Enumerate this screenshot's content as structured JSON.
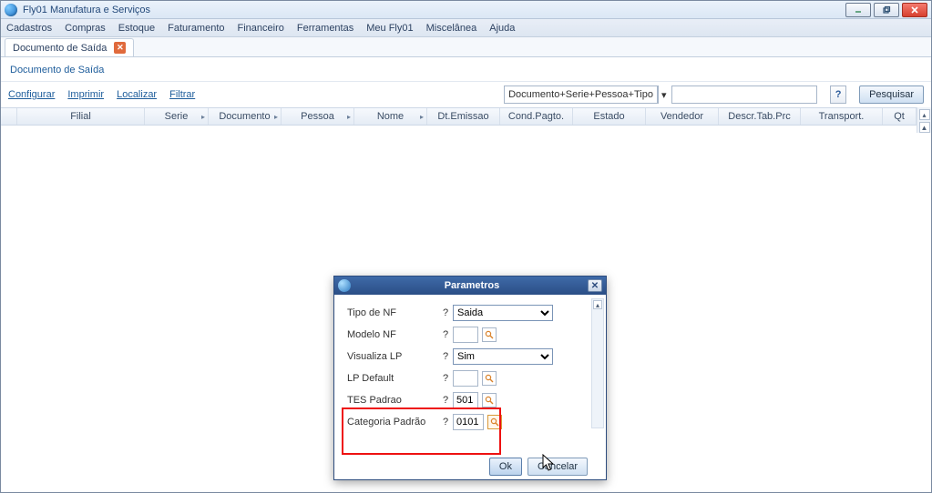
{
  "titlebar": {
    "title": "Fly01 Manufatura e Serviços"
  },
  "menubar": {
    "items": [
      "Cadastros",
      "Compras",
      "Estoque",
      "Faturamento",
      "Financeiro",
      "Ferramentas",
      "Meu Fly01",
      "Miscelânea",
      "Ajuda"
    ]
  },
  "tabs": {
    "active": {
      "label": "Documento de Saída"
    }
  },
  "panel": {
    "title": "Documento de Saída"
  },
  "toolbar": {
    "configurar": "Configurar",
    "imprimir": "Imprimir",
    "localizar": "Localizar",
    "filtrar": "Filtrar",
    "sort_combo": "Documento+Serie+Pessoa+Tipo",
    "search_value": "",
    "pesquisar": "Pesquisar"
  },
  "grid": {
    "columns": [
      "Filial",
      "Serie",
      "Documento",
      "Pessoa",
      "Nome",
      "Dt.Emissao",
      "Cond.Pagto.",
      "Estado",
      "Vendedor",
      "Descr.Tab.Prc",
      "Transport.",
      "Qt"
    ]
  },
  "dialog": {
    "title": "Parametros",
    "help_marker": "?",
    "rows": {
      "tipo_nf": {
        "label": "Tipo de NF",
        "value": "Saida"
      },
      "modelo_nf": {
        "label": "Modelo NF",
        "value": ""
      },
      "visualiza_lp": {
        "label": "Visualiza LP",
        "value": "Sim"
      },
      "lp_default": {
        "label": "LP Default",
        "value": ""
      },
      "tes_padrao": {
        "label": "TES Padrao",
        "value": "501"
      },
      "categoria_padrao": {
        "label": "Categoria Padrão",
        "value": "0101"
      }
    },
    "ok": "Ok",
    "cancelar": "Cancelar"
  }
}
